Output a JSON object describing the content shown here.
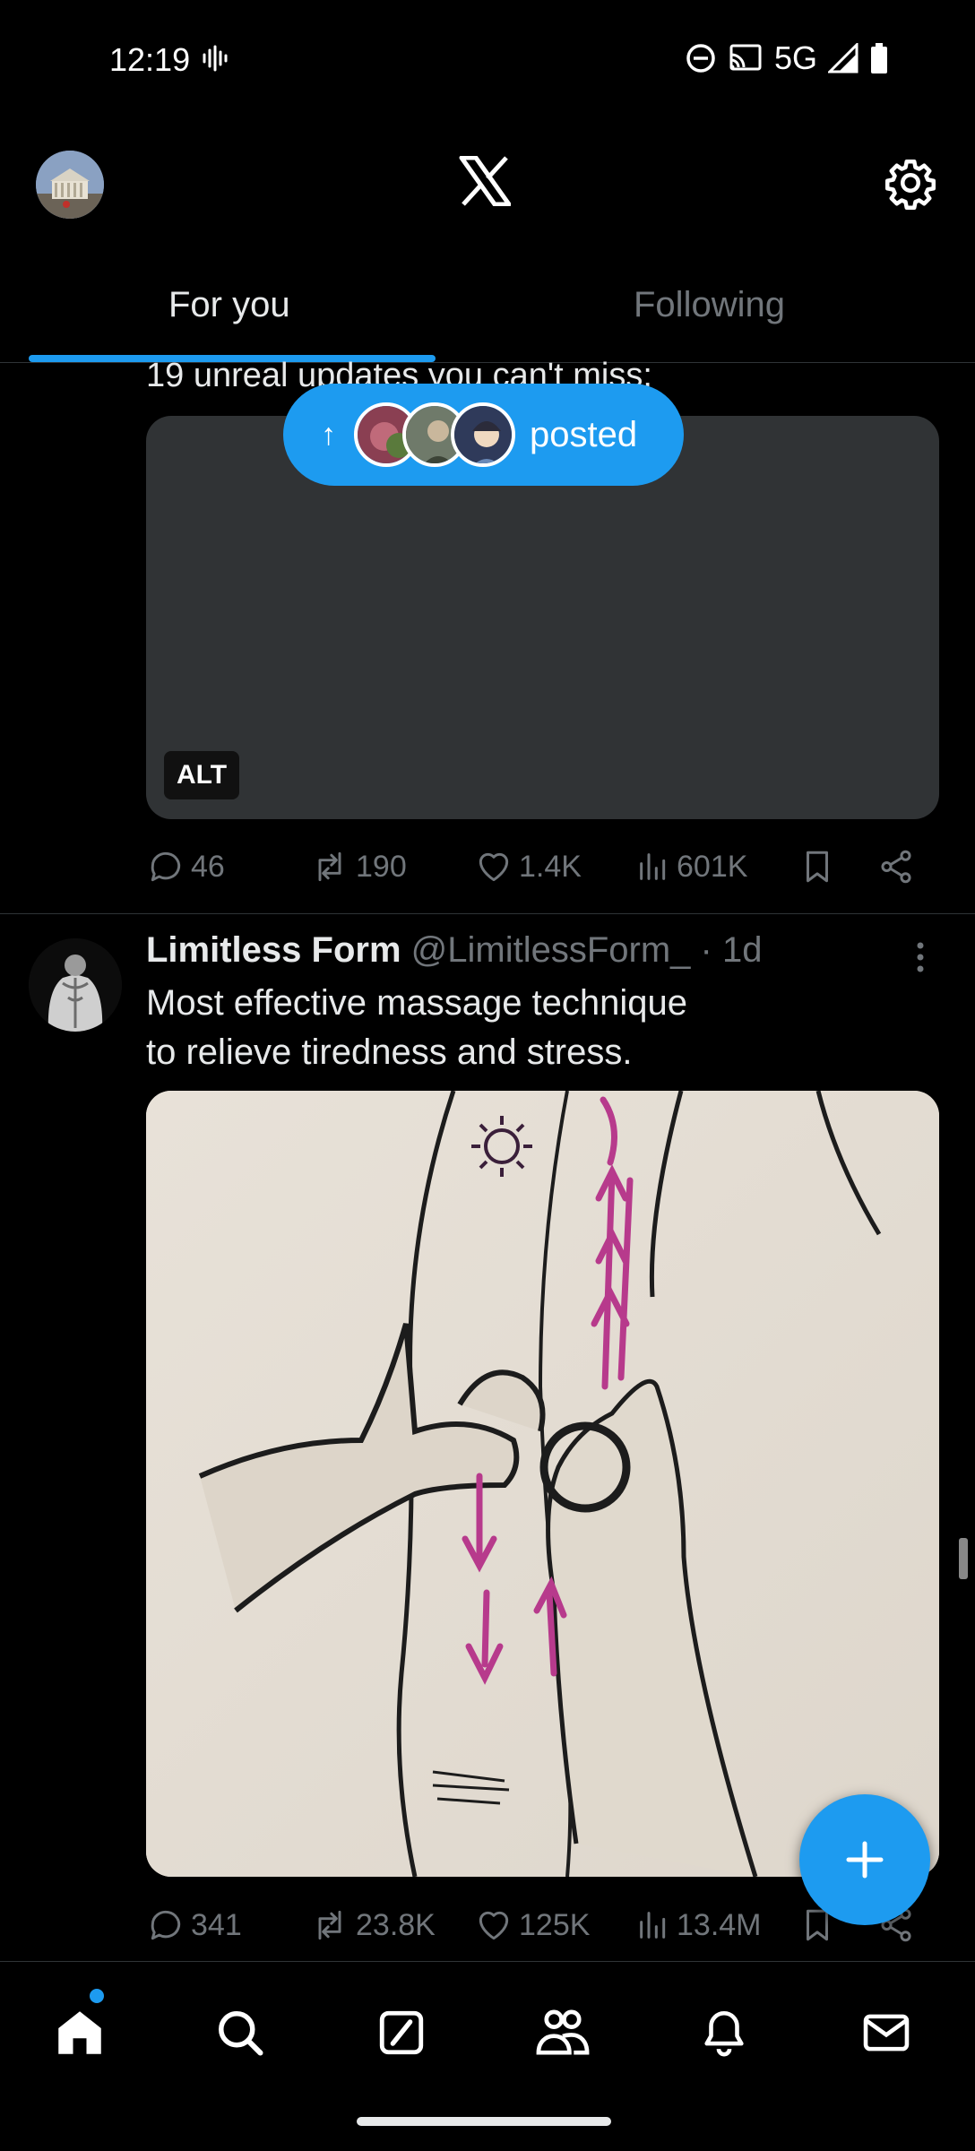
{
  "status_bar": {
    "time": "12:19",
    "network": "5G"
  },
  "header": {
    "logo": "x-logo-icon",
    "settings_icon": "gear-icon"
  },
  "tabs": [
    {
      "label": "For you",
      "active": true
    },
    {
      "label": "Following",
      "active": false
    }
  ],
  "posted_pill": {
    "label": "posted",
    "arrow_icon": "arrow-up-icon"
  },
  "tweet1": {
    "text": "19 unreal updates you can't miss:",
    "alt_badge": "ALT",
    "replies": "46",
    "reposts": "190",
    "likes": "1.4K",
    "views": "601K"
  },
  "tweet2": {
    "name": "Limitless Form",
    "handle": "@LimitlessForm_",
    "time": "· 1d",
    "text_line1": "Most effective massage technique",
    "text_line2": "to relieve tiredness and stress.",
    "replies": "341",
    "reposts": "23.8K",
    "likes": "125K",
    "views": "13.4M"
  },
  "bottom_nav": [
    "home-icon",
    "search-icon",
    "grok-icon",
    "communities-icon",
    "notifications-icon",
    "messages-icon"
  ],
  "colors": {
    "accent": "#1d9bf0",
    "background": "#000000",
    "text_primary": "#e7e9ea",
    "text_secondary": "#71767b",
    "divider": "#2f3336"
  }
}
